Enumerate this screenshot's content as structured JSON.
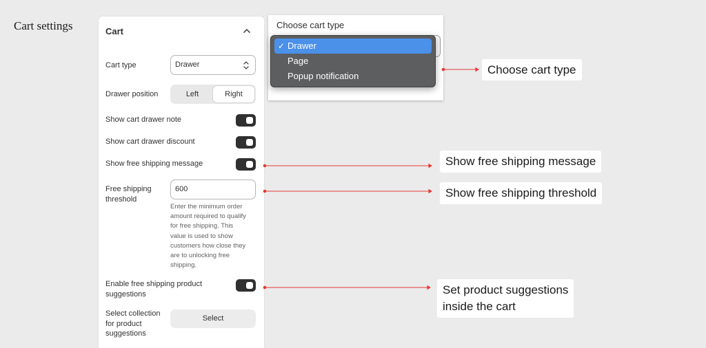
{
  "page_heading": "Cart settings",
  "panel": {
    "title": "Cart",
    "cart_type": {
      "label": "Cart type",
      "value": "Drawer"
    },
    "drawer_position": {
      "label": "Drawer position",
      "options": [
        "Left",
        "Right"
      ],
      "selected": "Right"
    },
    "show_drawer_note": {
      "label": "Show cart drawer note",
      "enabled": true
    },
    "show_drawer_discount": {
      "label": "Show cart drawer discount",
      "enabled": true
    },
    "show_free_shipping": {
      "label": "Show free shipping message",
      "enabled": true
    },
    "free_shipping_threshold": {
      "label_line1": "Free shipping",
      "label_line2": "threshold",
      "value": "600",
      "help_lines": [
        "Enter the minimum order",
        "amount required to qualify",
        "for free shipping. This",
        "value is used to show",
        "customers how close they",
        "are to unlocking free",
        "shipping."
      ]
    },
    "product_suggestions": {
      "label_line1": "Enable free shipping product",
      "label_line2": "suggestions",
      "enabled": true
    },
    "select_collection": {
      "label_lines": [
        "Select collection",
        "for product",
        "suggestions"
      ],
      "button": "Select"
    }
  },
  "popup": {
    "title": "Choose cart type",
    "options": [
      {
        "label": "Drawer",
        "check": "✓"
      },
      {
        "label": "Page",
        "check": ""
      },
      {
        "label": "Popup notification",
        "check": ""
      }
    ],
    "selected_index": 0
  },
  "callouts": {
    "choose_cart_type": "Choose cart type",
    "free_shipping_message": "Show free shipping message",
    "free_shipping_threshold": "Show free shipping threshold",
    "suggestions_line1": "Set product suggestions",
    "suggestions_line2": "inside the cart"
  },
  "colors": {
    "annotation_line": "#e53935",
    "toggle_on": "#303030",
    "dropdown_highlight": "#4b90e9",
    "dropdown_bg": "#5d5e60"
  }
}
